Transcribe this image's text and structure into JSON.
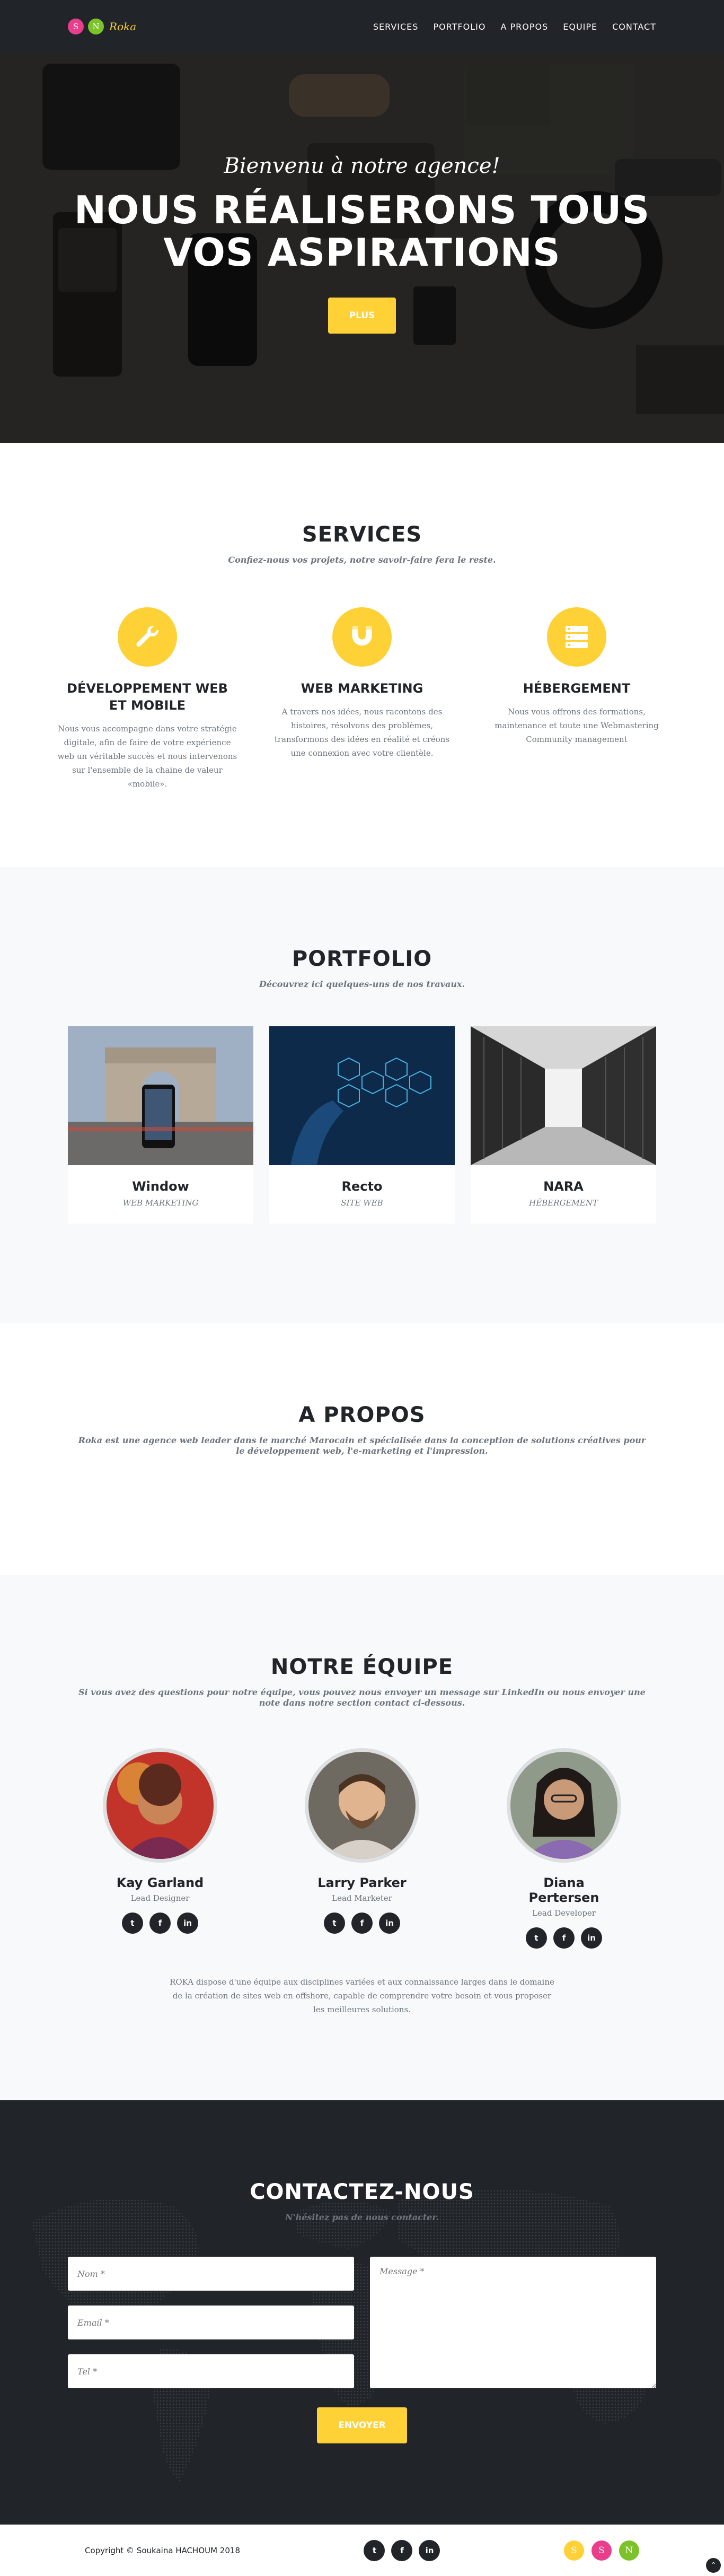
{
  "brand": {
    "logo_letters": [
      "S",
      "N"
    ],
    "logo_colors": [
      "#e83e8c",
      "#7cc229"
    ],
    "name": "Roka"
  },
  "nav": {
    "items": [
      "SERVICES",
      "PORTFOLIO",
      "A PROPOS",
      "EQUIPE",
      "CONTACT"
    ]
  },
  "hero": {
    "subheading": "Bienvenu à notre agence!",
    "heading_line1": "NOUS RÉALISERONS TOUS",
    "heading_line2": "VOS ASPIRATIONS",
    "button": "PLUS"
  },
  "services": {
    "heading": "SERVICES",
    "subheading": "Confiez-nous vos projets, notre savoir-faire fera le reste.",
    "items": [
      {
        "icon": "wrench-icon",
        "title": "DÉVELOPPEMENT WEB ET MOBILE",
        "text": "Nous vous accompagne dans votre stratégie digitale, afin de faire de votre expérience web un véritable succès et nous intervenons sur l'ensemble de la chaine de valeur «mobile»."
      },
      {
        "icon": "magnet-icon",
        "title": "WEB MARKETING",
        "text": "A travers nos idées, nous racontons des histoires, résolvons des problèmes, transformons des idées en réalité et créons une connexion avec votre clientèle."
      },
      {
        "icon": "server-icon",
        "title": "HÉBERGEMENT",
        "text": "Nous vous offrons des formations, maintenance et toute une Webmastering Community management"
      }
    ]
  },
  "portfolio": {
    "heading": "PORTFOLIO",
    "subheading": "Découvrez ici quelques-uns de nos travaux.",
    "items": [
      {
        "title": "Window",
        "category": "WEB MARKETING"
      },
      {
        "title": "Recto",
        "category": "SITE WEB"
      },
      {
        "title": "NARA",
        "category": "HÉBERGEMENT"
      }
    ]
  },
  "about": {
    "heading": "A PROPOS",
    "text": "Roka est une agence web leader dans le marché Marocain et spécialisée dans la conception de solutions créatives pour le développement web, l'e-marketing et l'impression."
  },
  "team": {
    "heading": "NOTRE ÉQUIPE",
    "subheading": "Si vous avez des questions pour notre équipe, vous pouvez nous envoyer un message sur LinkedIn ou nous envoyer une note dans notre section contact ci-dessous.",
    "members": [
      {
        "name": "Kay Garland",
        "role": "Lead Designer"
      },
      {
        "name": "Larry Parker",
        "role": "Lead Marketer"
      },
      {
        "name": "Diana Pertersen",
        "role": "Lead Developer"
      }
    ],
    "social_icons": [
      "twitter-icon",
      "facebook-icon",
      "linkedin-icon"
    ],
    "social_glyphs": [
      "t",
      "f",
      "in"
    ],
    "footer_text": "ROKA dispose d'une équipe aux disciplines variées et aux connaissance larges dans le domaine de la création de sites web en offshore, capable de comprendre votre besoin et vous proposer les meilleures solutions."
  },
  "contact": {
    "heading": "CONTACTEZ-NOUS",
    "subheading": "N'hésitez pas de nous contacter.",
    "name_placeholder": "Nom *",
    "email_placeholder": "Email *",
    "tel_placeholder": "Tel *",
    "message_placeholder": "Message *",
    "button": "ENVOYER"
  },
  "footer": {
    "copyright": "Copyright © Soukaina HACHOUM 2018",
    "logo_letters": [
      "S",
      "S",
      "N"
    ],
    "logo_colors": [
      "#fed136",
      "#e83e8c",
      "#7cc229"
    ]
  },
  "colors": {
    "accent": "#fed136",
    "dark": "#212529",
    "muted": "#6c757d",
    "light_bg": "#f8f9fa"
  }
}
